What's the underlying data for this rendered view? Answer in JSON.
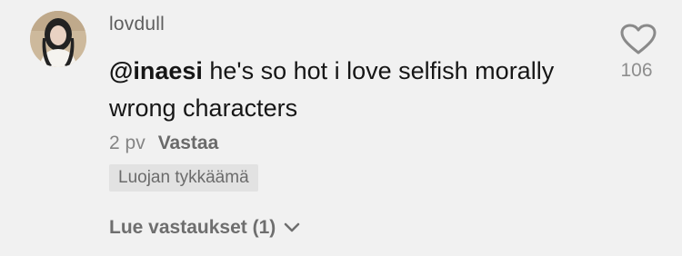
{
  "comment": {
    "username": "lovdull",
    "mention": "@inaesi",
    "text": " he's so hot i love selfish morally wrong characters",
    "age": "2 pv",
    "reply_label": "Vastaa",
    "creator_badge": "Luojan tykkäämä",
    "view_replies": "Lue vastaukset (1)",
    "like_count": "106"
  },
  "icons": {
    "like": "heart-outline-icon",
    "expand": "chevron-down-icon"
  },
  "colors": {
    "background": "#f1f1f1",
    "text": "#161616",
    "secondary": "#858585"
  }
}
